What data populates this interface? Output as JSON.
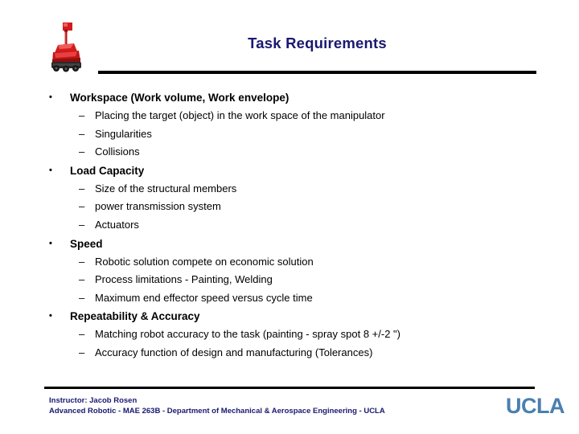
{
  "slide": {
    "title": "Task Requirements",
    "logo_icon": "red-mobile-robot-image",
    "sections": [
      {
        "heading": "Workspace (Work volume, Work envelope)",
        "marker": "•",
        "items": [
          "Placing the target (object) in the work space of the manipulator",
          "Singularities",
          "Collisions"
        ]
      },
      {
        "heading": "Load Capacity",
        "marker": "•",
        "items": [
          "Size of the structural members",
          "power transmission system",
          "Actuators"
        ]
      },
      {
        "heading": "Speed",
        "marker": "•",
        "items": [
          "Robotic solution compete on economic solution",
          "Process limitations - Painting, Welding",
          "Maximum end effector speed versus cycle time"
        ]
      },
      {
        "heading": "Repeatability & Accuracy",
        "marker": "•",
        "items": [
          "Matching robot accuracy to the task (painting - spray spot 8 +/-2 \")",
          "Accuracy function of design and manufacturing (Tolerances)"
        ]
      }
    ],
    "sub_marker": "–"
  },
  "footer": {
    "line1": "Instructor: Jacob Rosen",
    "line2": "Advanced Robotic - MAE 263B - Department of Mechanical & Aerospace Engineering - UCLA",
    "logo_text": "UCLA"
  },
  "colors": {
    "title_blue": "#191970",
    "footer_blue": "#191970",
    "ucla_blue": "#4a7fb0",
    "rule_black": "#000000",
    "robot_red": "#cc1111",
    "background": "#ffffff"
  }
}
